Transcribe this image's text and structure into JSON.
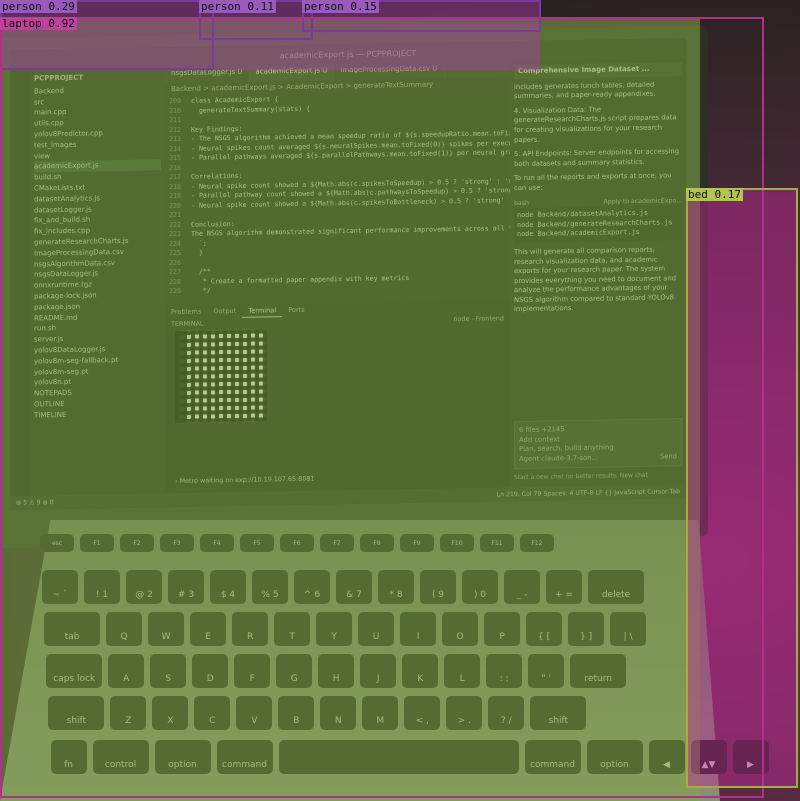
{
  "colors": {
    "person_box": "#7a3a9a",
    "laptop_box": "#b0308a",
    "bed_box": "#a0b040",
    "segmentation_tint": "#82aa46"
  },
  "detections": [
    {
      "label": "person 0.29",
      "class": "person"
    },
    {
      "label": "person 0.11",
      "class": "person"
    },
    {
      "label": "person 0.15",
      "class": "person"
    },
    {
      "label": "laptop 0.92",
      "class": "laptop"
    },
    {
      "label": "bed 0.17",
      "class": "bed"
    }
  ],
  "ide": {
    "window_title": "academicExport.js — PCPPROJECT",
    "explorer_title": "PCPPROJECT",
    "files": [
      "Backend",
      "src",
      "main.cpp",
      "utils.cpp",
      "yolov8Predictor.cpp",
      "test_images",
      "view",
      "academicExport.js",
      "build.sh",
      "CMakeLists.txt",
      "datasetAnalytics.js",
      "datasetLogger.js",
      "fix_and_build.sh",
      "fix_includes.cpp",
      "generateResearchCharts.js",
      "ImageProcessingData.csv",
      "nsgsAlgorithmData.csv",
      "nsgsDataLogger.js",
      "onnxruntime.tgz",
      "package-lock.json",
      "package.json",
      "README.md",
      "run.sh",
      "server.js",
      "yolov8DataLogger.js",
      "yolov8m-seg-fallback.pt",
      "yolov8m-seg.pt",
      "yolov8n.pt",
      "NOTEPADS",
      "OUTLINE",
      "TIMELINE"
    ],
    "tabs": [
      "nsgsDataLogger.js U",
      "academicExport.js U",
      "imageProcessingData.csv U"
    ],
    "breadcrumb": "Backend > academicExport.js > AcademicExport > generateTextSummary",
    "code": [
      {
        "ln": "209",
        "text": "class AcademicExport {"
      },
      {
        "ln": "210",
        "text": "  generateTextSummary(stats) {"
      },
      {
        "ln": "211",
        "text": ""
      },
      {
        "ln": "212",
        "text": "Key Findings:"
      },
      {
        "ln": "213",
        "text": "- The NSGS algorithm achieved a mean speedup ratio of ${s.speedupRatio.mean.toFixed(2)}"
      },
      {
        "ln": "214",
        "text": "- Neural spikes count averaged ${s.neuralSpikes.mean.toFixed(0)} spikes per execution"
      },
      {
        "ln": "215",
        "text": "- Parallel pathways averaged ${s.parallelPathways.mean.toFixed(1)} per neural graph"
      },
      {
        "ln": "216",
        "text": ""
      },
      {
        "ln": "217",
        "text": "Correlations:"
      },
      {
        "ln": "218",
        "text": "- Neural spike count showed a ${Math.abs(c.spikesToSpeedup) > 0.5 ? 'strong' : 'moderate'}"
      },
      {
        "ln": "219",
        "text": "- Parallel pathway count showed a ${Math.abs(c.pathwaysToSpeedup) > 0.5 ? 'strong' : 'm'}"
      },
      {
        "ln": "220",
        "text": "- Neural spike count showed a ${Math.abs(c.spikesToBottleneck) > 0.5 ? 'strong' : 'mode'}"
      },
      {
        "ln": "221",
        "text": ""
      },
      {
        "ln": "222",
        "text": "Conclusion:"
      },
      {
        "ln": "223",
        "text": "The NSGS algorithm demonstrated significant performance improvements across all tested"
      },
      {
        "ln": "224",
        "text": "  `;"
      },
      {
        "ln": "225",
        "text": "  }"
      },
      {
        "ln": "226",
        "text": ""
      },
      {
        "ln": "227",
        "text": "  /**"
      },
      {
        "ln": "228",
        "text": "   * Create a formatted paper appendix with key metrics"
      },
      {
        "ln": "229",
        "text": "   */"
      }
    ],
    "panel_tabs": [
      "Problems",
      "Output",
      "Terminal",
      "Ports"
    ],
    "terminal_header": "TERMINAL",
    "terminal_status": "node - Frontend",
    "metro_line": "› Metro waiting on exp://10.19.107.65:8081",
    "chat_title": "Comprehensive Image Dataset ...",
    "chat_paragraphs": [
      "includes generates lunch tables, detailed summaries, and paper-ready appendixes.",
      "4. Visualization Data: The generateResearchCharts.js script prepares data for creating visualizations for your research papers.",
      "5. API Endpoints: Server endpoints for accessing both datasets and summary statistics.",
      "To run all the reports and exports at once, you can use:"
    ],
    "chat_cmd_label": "bash",
    "chat_apply": "Apply to academicExpo...",
    "chat_commands": [
      "node Backend/datasetAnalytics.js",
      "node Backend/generateResearchCharts.js",
      "node Backend/academicExport.js"
    ],
    "chat_summary": "This will generate all comparison reports, research visualization data, and academic exports for your research paper. The system provides everything you need to document and analyze the performance advantages of your NSGS algorithm compared to standard YOLOv8 implementations.",
    "chat_files": "6 files +2145",
    "chat_add_context": "Add context",
    "chat_placeholder": "Plan, search, build anything",
    "chat_agent": "Agent  claude-3.7-son...",
    "chat_send": "Send",
    "chat_hint": "Start a new chat for better results.   New chat",
    "status_left": "⊗ 5 ⚠ 9   ⊕ 0",
    "status_right": "Ln 219, Col 79   Spaces: 4   UTF-8   LF   {} JavaScript   Cursor Tab"
  },
  "keyboard": {
    "fn_row": [
      "esc",
      "F1",
      "F2",
      "F3",
      "F4",
      "F5",
      "F6",
      "F7",
      "F8",
      "F9",
      "F10",
      "F11",
      "F12"
    ],
    "num_row": [
      "~ `",
      "! 1",
      "@ 2",
      "# 3",
      "$ 4",
      "% 5",
      "^ 6",
      "& 7",
      "* 8",
      "( 9",
      ") 0",
      "_ -",
      "+ =",
      "delete"
    ],
    "q_row": [
      "tab",
      "Q",
      "W",
      "E",
      "R",
      "T",
      "Y",
      "U",
      "I",
      "O",
      "P",
      "{ [",
      "} ]",
      "| \\"
    ],
    "a_row": [
      "caps lock",
      "A",
      "S",
      "D",
      "F",
      "G",
      "H",
      "J",
      "K",
      "L",
      ": ;",
      "\" '",
      "return"
    ],
    "z_row": [
      "shift",
      "Z",
      "X",
      "C",
      "V",
      "B",
      "N",
      "M",
      "< ,",
      "> .",
      "? /",
      "shift"
    ],
    "bottom_row": [
      "fn",
      "control",
      "option",
      "command",
      "",
      "command",
      "option",
      "◀",
      "▲▼",
      "▶"
    ]
  }
}
